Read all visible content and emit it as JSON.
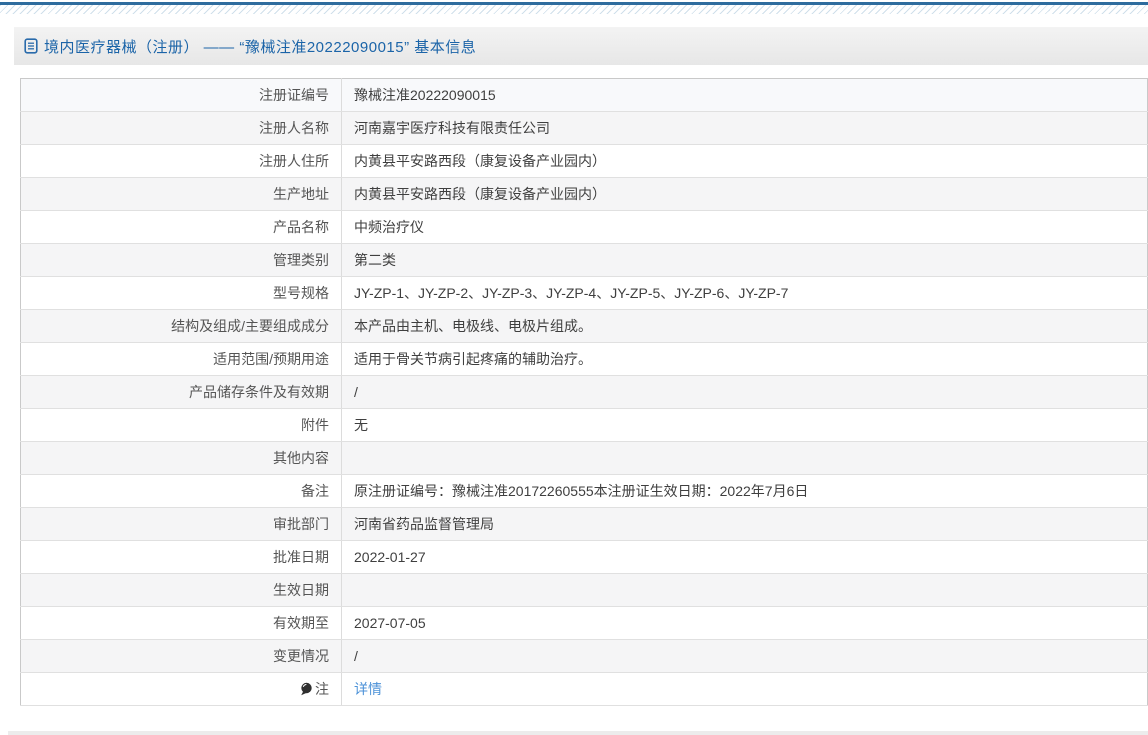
{
  "header": {
    "title": "境内医疗器械（注册） —— “豫械注准20222090015” 基本信息"
  },
  "colors": {
    "accent_blue": "#1b64a8",
    "top_line_blue": "#2e6c9e",
    "link_blue": "#4c92d8",
    "stripe_gray": "#f5f5f6"
  },
  "table": {
    "rows": [
      {
        "label": "注册证编号",
        "value": "豫械注准20222090015"
      },
      {
        "label": "注册人名称",
        "value": "河南嘉宇医疗科技有限责任公司"
      },
      {
        "label": "注册人住所",
        "value": "内黄县平安路西段（康复设备产业园内）"
      },
      {
        "label": "生产地址",
        "value": "内黄县平安路西段（康复设备产业园内）"
      },
      {
        "label": "产品名称",
        "value": "中频治疗仪"
      },
      {
        "label": "管理类别",
        "value": "第二类"
      },
      {
        "label": "型号规格",
        "value": "JY-ZP-1、JY-ZP-2、JY-ZP-3、JY-ZP-4、JY-ZP-5、JY-ZP-6、JY-ZP-7"
      },
      {
        "label": "结构及组成/主要组成成分",
        "value": "本产品由主机、电极线、电极片组成。"
      },
      {
        "label": "适用范围/预期用途",
        "value": "适用于骨关节病引起疼痛的辅助治疗。"
      },
      {
        "label": "产品储存条件及有效期",
        "value": "/"
      },
      {
        "label": "附件",
        "value": "无"
      },
      {
        "label": "其他内容",
        "value": ""
      },
      {
        "label": "备注",
        "value": "原注册证编号：豫械注准20172260555本注册证生效日期：2022年7月6日"
      },
      {
        "label": "审批部门",
        "value": "河南省药品监督管理局"
      },
      {
        "label": "批准日期",
        "value": "2022-01-27"
      },
      {
        "label": "生效日期",
        "value": ""
      },
      {
        "label": "有效期至",
        "value": "2027-07-05"
      },
      {
        "label": "变更情况",
        "value": "/"
      },
      {
        "label": "注",
        "value": "详情"
      }
    ]
  }
}
